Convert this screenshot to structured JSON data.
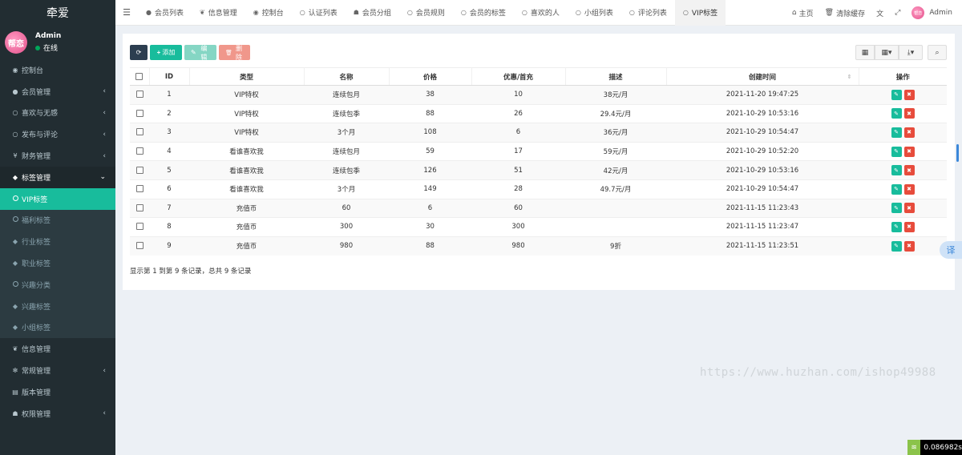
{
  "brand": "牵爱",
  "user": {
    "avatar_text": "帮恋",
    "name": "Admin",
    "status": "在线"
  },
  "sidebar": {
    "items": [
      {
        "label": "控制台",
        "icon": "dashboard-icon",
        "glyph": "◉",
        "caret": ""
      },
      {
        "label": "会员管理",
        "icon": "user-icon",
        "glyph": "●",
        "caret": "‹"
      },
      {
        "label": "喜欢与无感",
        "icon": "circle-icon",
        "glyph": "○",
        "caret": "‹"
      },
      {
        "label": "发布与评论",
        "icon": "circle-icon",
        "glyph": "○",
        "caret": "‹"
      },
      {
        "label": "财务管理",
        "icon": "yen-icon",
        "glyph": "¥",
        "caret": "‹"
      },
      {
        "label": "标签管理",
        "icon": "tag-icon",
        "glyph": "◆",
        "caret": "⌄"
      }
    ],
    "submenu": [
      {
        "label": "VIP标签",
        "icon": "circle-icon",
        "active": true
      },
      {
        "label": "福利标签",
        "icon": "circle-icon",
        "active": false
      },
      {
        "label": "行业标签",
        "icon": "tag-icon",
        "active": false
      },
      {
        "label": "职业标签",
        "icon": "tag-icon",
        "active": false
      },
      {
        "label": "兴趣分类",
        "icon": "circle-icon",
        "active": false
      },
      {
        "label": "兴趣标签",
        "icon": "tag-icon",
        "active": false
      },
      {
        "label": "小组标签",
        "icon": "tag-icon",
        "active": false
      }
    ],
    "items_after": [
      {
        "label": "信息管理",
        "icon": "leaf-icon",
        "glyph": "❦",
        "caret": ""
      },
      {
        "label": "常规管理",
        "icon": "cogs-icon",
        "glyph": "✻",
        "caret": "‹"
      },
      {
        "label": "版本管理",
        "icon": "file-icon",
        "glyph": "▤",
        "caret": ""
      },
      {
        "label": "权限管理",
        "icon": "group-icon",
        "glyph": "☗",
        "caret": "‹"
      }
    ]
  },
  "topbar": {
    "tabs": [
      {
        "label": "会员列表",
        "glyph": "●",
        "icon": "user-icon"
      },
      {
        "label": "信息管理",
        "glyph": "❦",
        "icon": "leaf-icon"
      },
      {
        "label": "控制台",
        "glyph": "◉",
        "icon": "dashboard-icon"
      },
      {
        "label": "认证列表",
        "glyph": "○",
        "icon": "circle-icon"
      },
      {
        "label": "会员分组",
        "glyph": "☗",
        "icon": "group-icon"
      },
      {
        "label": "会员规则",
        "glyph": "○",
        "icon": "circle-icon"
      },
      {
        "label": "会员的标签",
        "glyph": "○",
        "icon": "circle-icon"
      },
      {
        "label": "喜欢的人",
        "glyph": "○",
        "icon": "circle-icon"
      },
      {
        "label": "小组列表",
        "glyph": "○",
        "icon": "circle-icon"
      },
      {
        "label": "评论列表",
        "glyph": "○",
        "icon": "circle-icon"
      },
      {
        "label": "VIP标签",
        "glyph": "○",
        "icon": "circle-icon",
        "active": true
      }
    ],
    "home_label": "主页",
    "clear_cache_label": "清除缓存",
    "admin_label": "Admin",
    "avatar_text": "帮恋"
  },
  "toolbar": {
    "refresh_glyph": "⟳",
    "add_label": "添加",
    "edit_label": "编辑",
    "delete_label": "删除",
    "add_glyph": "+",
    "edit_glyph": "✎",
    "delete_glyph": "🗑"
  },
  "table": {
    "headers": [
      "ID",
      "类型",
      "名称",
      "价格",
      "优惠/首充",
      "描述",
      "创建时间",
      "操作"
    ],
    "rows": [
      {
        "id": "1",
        "type": "VIP特权",
        "name": "连续包月",
        "price": "38",
        "discount": "10",
        "desc": "38元/月",
        "created": "2021-11-20 19:47:25"
      },
      {
        "id": "2",
        "type": "VIP特权",
        "name": "连续包季",
        "price": "88",
        "discount": "26",
        "desc": "29.4元/月",
        "created": "2021-10-29 10:53:16"
      },
      {
        "id": "3",
        "type": "VIP特权",
        "name": "3个月",
        "price": "108",
        "discount": "6",
        "desc": "36元/月",
        "created": "2021-10-29 10:54:47"
      },
      {
        "id": "4",
        "type": "看谁喜欢我",
        "name": "连续包月",
        "price": "59",
        "discount": "17",
        "desc": "59元/月",
        "created": "2021-10-29 10:52:20"
      },
      {
        "id": "5",
        "type": "看谁喜欢我",
        "name": "连续包季",
        "price": "126",
        "discount": "51",
        "desc": "42元/月",
        "created": "2021-10-29 10:53:16"
      },
      {
        "id": "6",
        "type": "看谁喜欢我",
        "name": "3个月",
        "price": "149",
        "discount": "28",
        "desc": "49.7元/月",
        "created": "2021-10-29 10:54:47"
      },
      {
        "id": "7",
        "type": "充值币",
        "name": "60",
        "price": "6",
        "discount": "60",
        "desc": "",
        "created": "2021-11-15 11:23:43"
      },
      {
        "id": "8",
        "type": "充值币",
        "name": "300",
        "price": "30",
        "discount": "300",
        "desc": "",
        "created": "2021-11-15 11:23:47"
      },
      {
        "id": "9",
        "type": "充值币",
        "name": "980",
        "price": "88",
        "discount": "980",
        "desc": "9折",
        "created": "2021-11-15 11:23:51"
      }
    ]
  },
  "pagination_info": "显示第 1 到第 9 条记录，总共 9 条记录",
  "watermark": "https://www.huzhan.com/ishop49988",
  "translate_label": "译",
  "timer": "0.086982s"
}
